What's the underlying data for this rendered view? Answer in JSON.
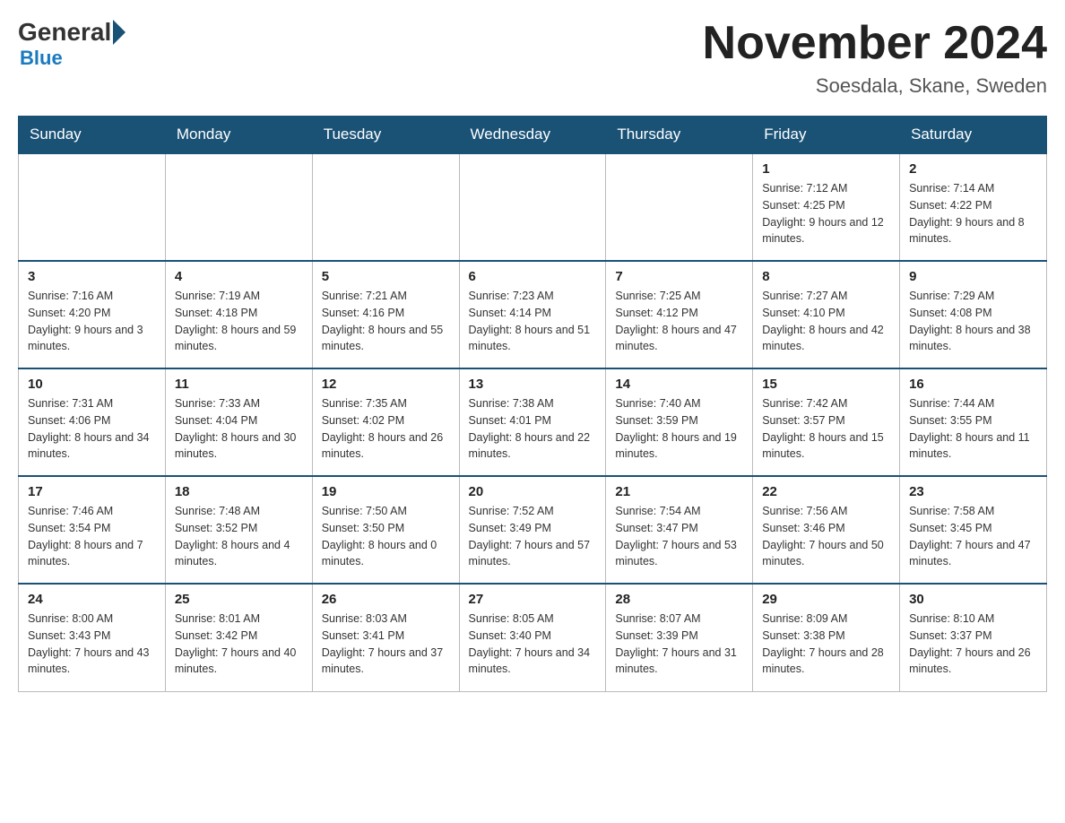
{
  "logo": {
    "general": "General",
    "blue": "Blue"
  },
  "title": "November 2024",
  "location": "Soesdala, Skane, Sweden",
  "days_of_week": [
    "Sunday",
    "Monday",
    "Tuesday",
    "Wednesday",
    "Thursday",
    "Friday",
    "Saturday"
  ],
  "weeks": [
    [
      {
        "day": "",
        "info": ""
      },
      {
        "day": "",
        "info": ""
      },
      {
        "day": "",
        "info": ""
      },
      {
        "day": "",
        "info": ""
      },
      {
        "day": "",
        "info": ""
      },
      {
        "day": "1",
        "info": "Sunrise: 7:12 AM\nSunset: 4:25 PM\nDaylight: 9 hours and 12 minutes."
      },
      {
        "day": "2",
        "info": "Sunrise: 7:14 AM\nSunset: 4:22 PM\nDaylight: 9 hours and 8 minutes."
      }
    ],
    [
      {
        "day": "3",
        "info": "Sunrise: 7:16 AM\nSunset: 4:20 PM\nDaylight: 9 hours and 3 minutes."
      },
      {
        "day": "4",
        "info": "Sunrise: 7:19 AM\nSunset: 4:18 PM\nDaylight: 8 hours and 59 minutes."
      },
      {
        "day": "5",
        "info": "Sunrise: 7:21 AM\nSunset: 4:16 PM\nDaylight: 8 hours and 55 minutes."
      },
      {
        "day": "6",
        "info": "Sunrise: 7:23 AM\nSunset: 4:14 PM\nDaylight: 8 hours and 51 minutes."
      },
      {
        "day": "7",
        "info": "Sunrise: 7:25 AM\nSunset: 4:12 PM\nDaylight: 8 hours and 47 minutes."
      },
      {
        "day": "8",
        "info": "Sunrise: 7:27 AM\nSunset: 4:10 PM\nDaylight: 8 hours and 42 minutes."
      },
      {
        "day": "9",
        "info": "Sunrise: 7:29 AM\nSunset: 4:08 PM\nDaylight: 8 hours and 38 minutes."
      }
    ],
    [
      {
        "day": "10",
        "info": "Sunrise: 7:31 AM\nSunset: 4:06 PM\nDaylight: 8 hours and 34 minutes."
      },
      {
        "day": "11",
        "info": "Sunrise: 7:33 AM\nSunset: 4:04 PM\nDaylight: 8 hours and 30 minutes."
      },
      {
        "day": "12",
        "info": "Sunrise: 7:35 AM\nSunset: 4:02 PM\nDaylight: 8 hours and 26 minutes."
      },
      {
        "day": "13",
        "info": "Sunrise: 7:38 AM\nSunset: 4:01 PM\nDaylight: 8 hours and 22 minutes."
      },
      {
        "day": "14",
        "info": "Sunrise: 7:40 AM\nSunset: 3:59 PM\nDaylight: 8 hours and 19 minutes."
      },
      {
        "day": "15",
        "info": "Sunrise: 7:42 AM\nSunset: 3:57 PM\nDaylight: 8 hours and 15 minutes."
      },
      {
        "day": "16",
        "info": "Sunrise: 7:44 AM\nSunset: 3:55 PM\nDaylight: 8 hours and 11 minutes."
      }
    ],
    [
      {
        "day": "17",
        "info": "Sunrise: 7:46 AM\nSunset: 3:54 PM\nDaylight: 8 hours and 7 minutes."
      },
      {
        "day": "18",
        "info": "Sunrise: 7:48 AM\nSunset: 3:52 PM\nDaylight: 8 hours and 4 minutes."
      },
      {
        "day": "19",
        "info": "Sunrise: 7:50 AM\nSunset: 3:50 PM\nDaylight: 8 hours and 0 minutes."
      },
      {
        "day": "20",
        "info": "Sunrise: 7:52 AM\nSunset: 3:49 PM\nDaylight: 7 hours and 57 minutes."
      },
      {
        "day": "21",
        "info": "Sunrise: 7:54 AM\nSunset: 3:47 PM\nDaylight: 7 hours and 53 minutes."
      },
      {
        "day": "22",
        "info": "Sunrise: 7:56 AM\nSunset: 3:46 PM\nDaylight: 7 hours and 50 minutes."
      },
      {
        "day": "23",
        "info": "Sunrise: 7:58 AM\nSunset: 3:45 PM\nDaylight: 7 hours and 47 minutes."
      }
    ],
    [
      {
        "day": "24",
        "info": "Sunrise: 8:00 AM\nSunset: 3:43 PM\nDaylight: 7 hours and 43 minutes."
      },
      {
        "day": "25",
        "info": "Sunrise: 8:01 AM\nSunset: 3:42 PM\nDaylight: 7 hours and 40 minutes."
      },
      {
        "day": "26",
        "info": "Sunrise: 8:03 AM\nSunset: 3:41 PM\nDaylight: 7 hours and 37 minutes."
      },
      {
        "day": "27",
        "info": "Sunrise: 8:05 AM\nSunset: 3:40 PM\nDaylight: 7 hours and 34 minutes."
      },
      {
        "day": "28",
        "info": "Sunrise: 8:07 AM\nSunset: 3:39 PM\nDaylight: 7 hours and 31 minutes."
      },
      {
        "day": "29",
        "info": "Sunrise: 8:09 AM\nSunset: 3:38 PM\nDaylight: 7 hours and 28 minutes."
      },
      {
        "day": "30",
        "info": "Sunrise: 8:10 AM\nSunset: 3:37 PM\nDaylight: 7 hours and 26 minutes."
      }
    ]
  ]
}
